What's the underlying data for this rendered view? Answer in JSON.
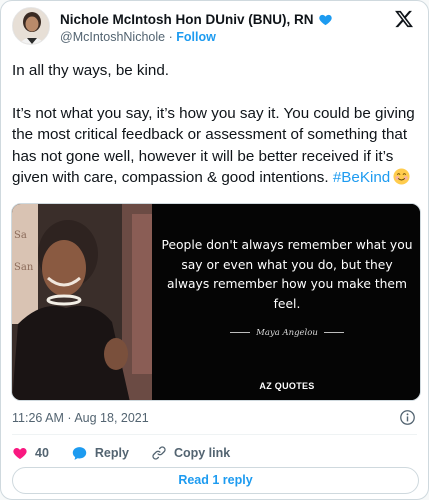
{
  "author": {
    "display_name": "Nichole McIntosh Hon DUniv (BNU), RN",
    "handle": "@McIntoshNichole",
    "separator": "·",
    "follow_label": "Follow",
    "verified_icon": "verified-heart-icon"
  },
  "tweet": {
    "line1": "In all thy ways, be kind.",
    "body": "It’s not what you say, it’s how you say it. You could be giving the most critical feedback or assessment of something that has not gone well, however it will be better received if it’s given with care, compassion & good intentions.",
    "hashtag": "#BeKind",
    "emoji": "smiling-face-emoji"
  },
  "media": {
    "quote": "People don't always remember what you say or even what you do, but they always remember how you make them feel.",
    "author": "Maya Angelou",
    "brand": "AZ QUOTES"
  },
  "meta": {
    "time": "11:26 AM",
    "separator": "·",
    "date": "Aug 18, 2021"
  },
  "actions": {
    "like_count": "40",
    "reply_label": "Reply",
    "copy_label": "Copy link"
  },
  "read_replies_label": "Read 1 reply",
  "colors": {
    "accent": "#1d9bf0",
    "like": "#f91880",
    "text": "#0f1419",
    "muted": "#536471"
  }
}
